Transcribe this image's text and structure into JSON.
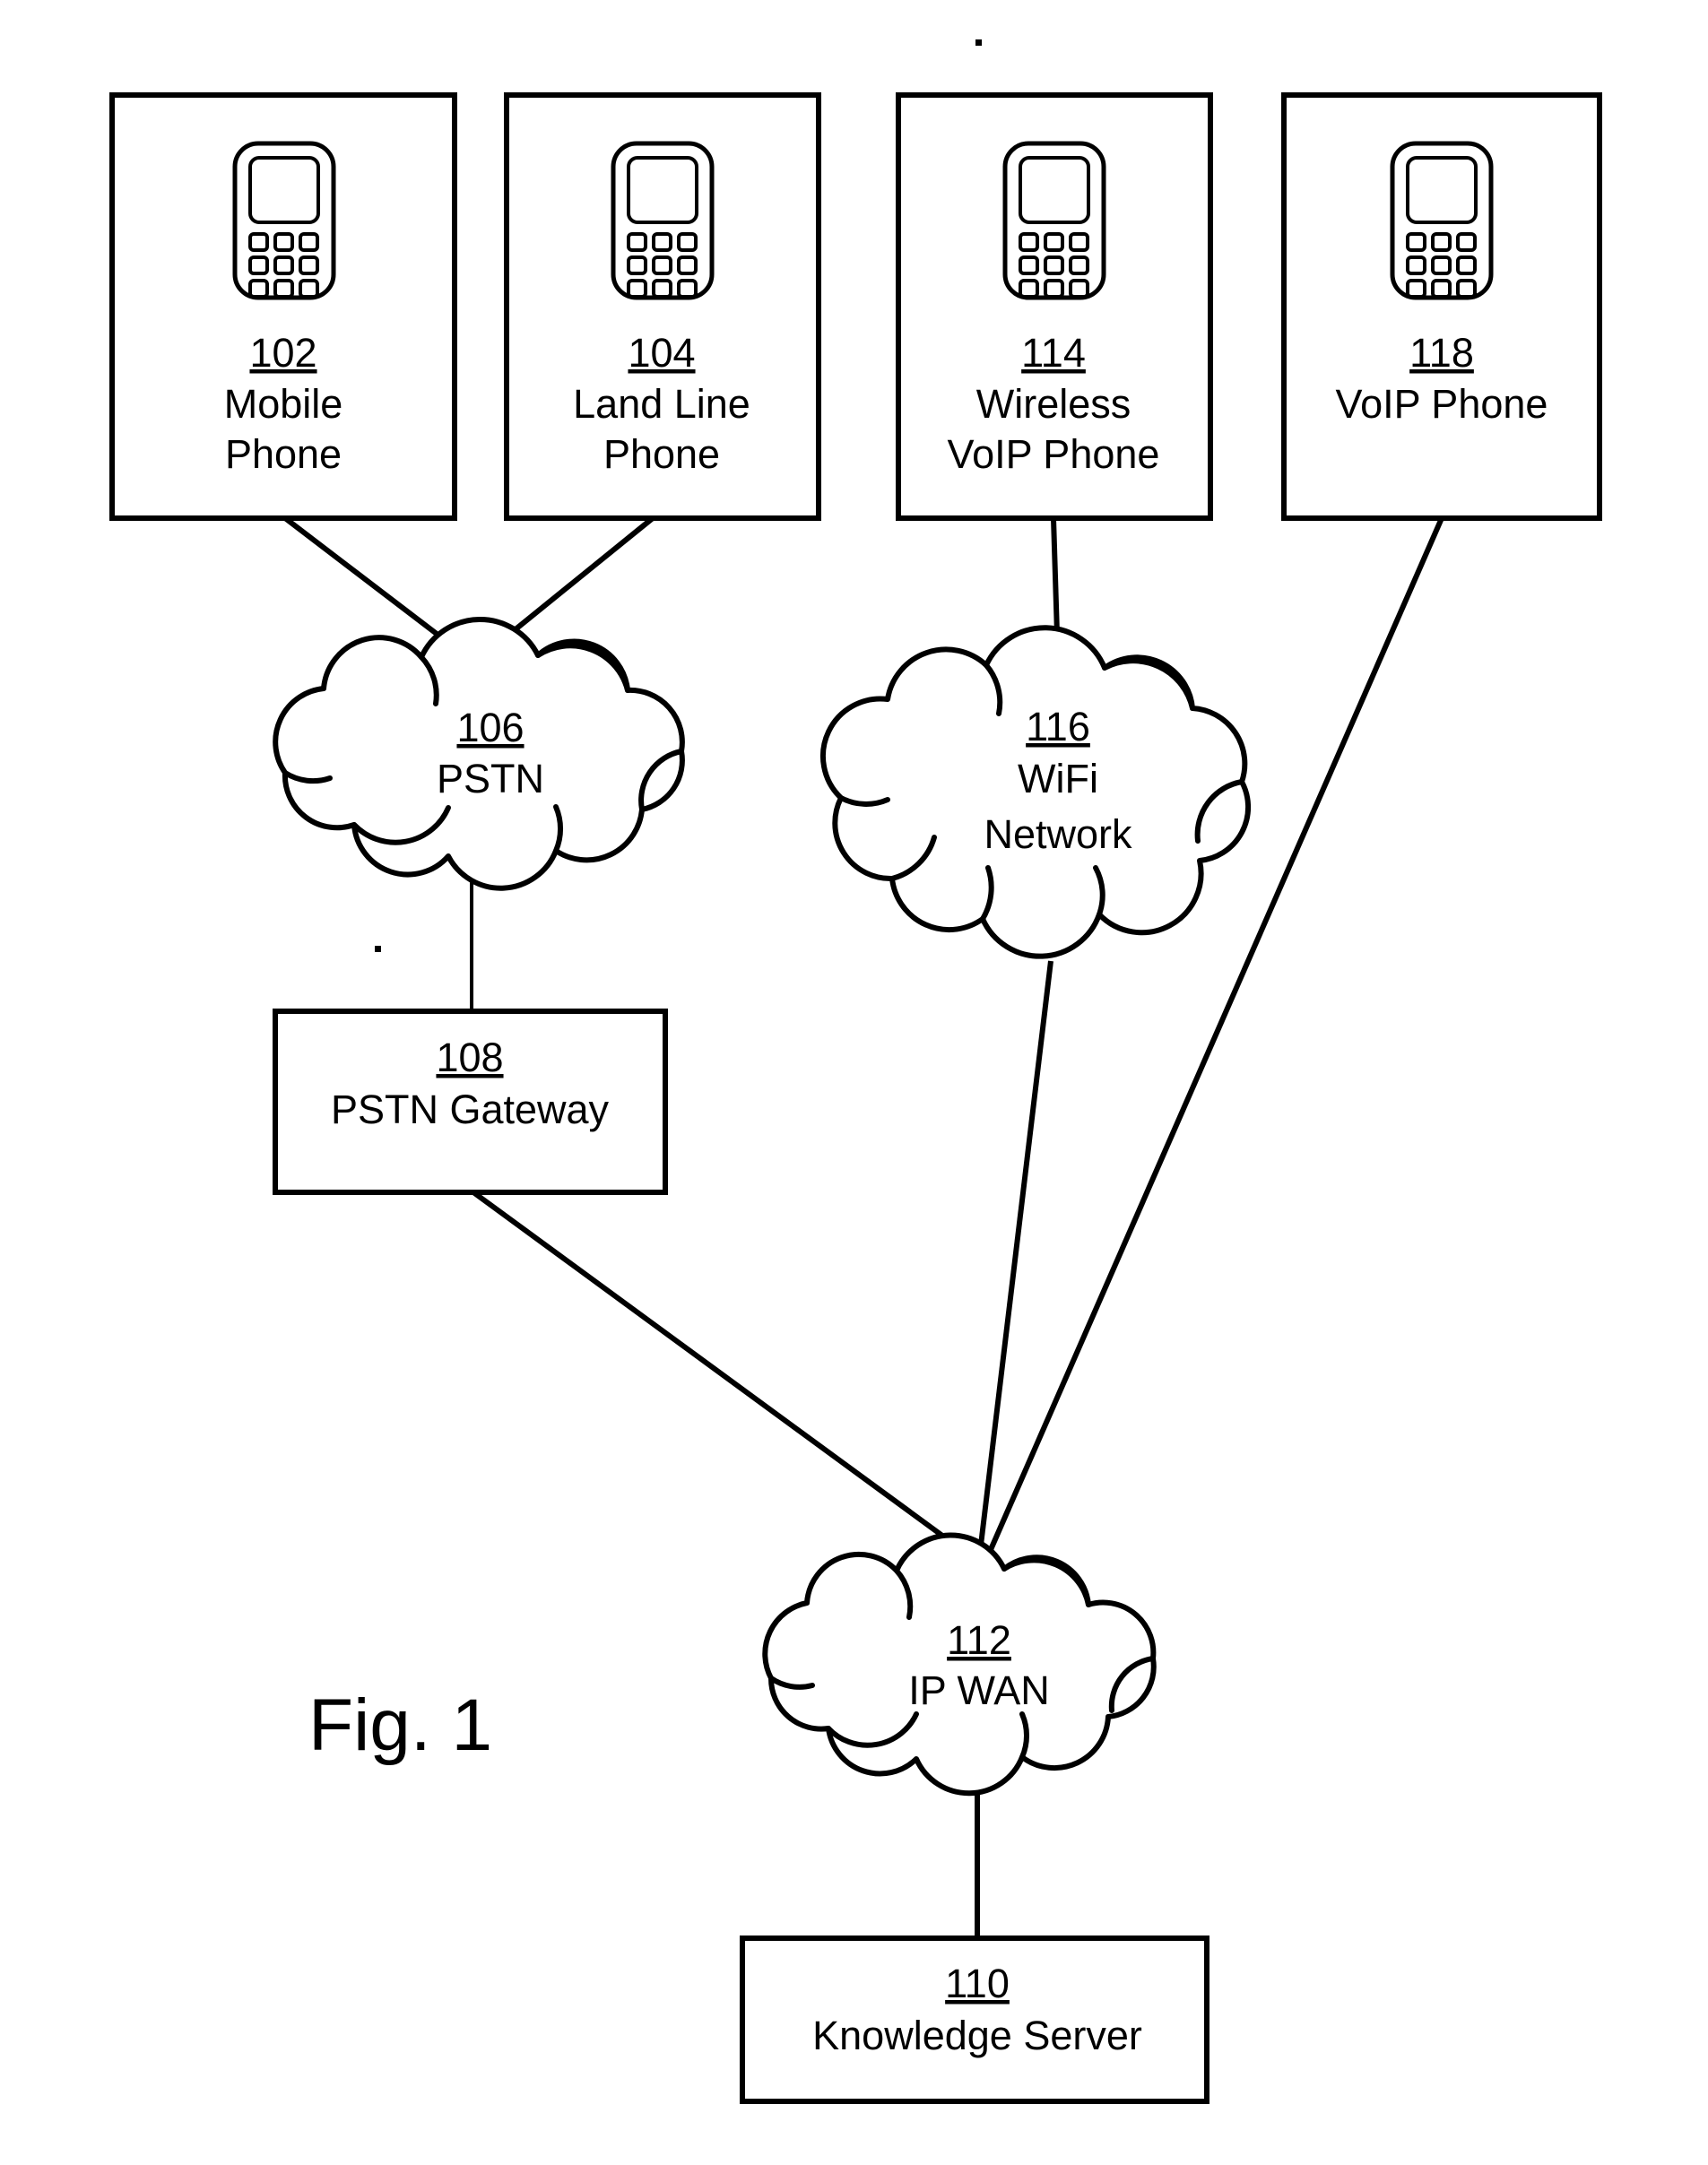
{
  "figure": {
    "caption": "Fig. 1"
  },
  "nodes": [
    {
      "id": "mobile-phone",
      "ref": "102",
      "label_lines": [
        "Mobile",
        "Phone"
      ],
      "shape": "box",
      "icon": "mobile-phone-icon"
    },
    {
      "id": "land-line-phone",
      "ref": "104",
      "label_lines": [
        "Land Line",
        "Phone"
      ],
      "shape": "box",
      "icon": "mobile-phone-icon"
    },
    {
      "id": "wireless-voip-phone",
      "ref": "114",
      "label_lines": [
        "Wireless",
        "VoIP Phone"
      ],
      "shape": "box",
      "icon": "mobile-phone-icon"
    },
    {
      "id": "voip-phone",
      "ref": "118",
      "label_lines": [
        "VoIP Phone"
      ],
      "shape": "box",
      "icon": "mobile-phone-icon"
    },
    {
      "id": "pstn",
      "ref": "106",
      "label_lines": [
        "PSTN"
      ],
      "shape": "cloud"
    },
    {
      "id": "wifi-network",
      "ref": "116",
      "label_lines": [
        "WiFi",
        "Network"
      ],
      "shape": "cloud"
    },
    {
      "id": "pstn-gateway",
      "ref": "108",
      "label_lines": [
        "PSTN Gateway"
      ],
      "shape": "box"
    },
    {
      "id": "ip-wan",
      "ref": "112",
      "label_lines": [
        "IP WAN"
      ],
      "shape": "cloud"
    },
    {
      "id": "knowledge-server",
      "ref": "110",
      "label_lines": [
        "Knowledge Server"
      ],
      "shape": "box"
    }
  ],
  "connections": [
    {
      "from": "mobile-phone",
      "to": "pstn"
    },
    {
      "from": "land-line-phone",
      "to": "pstn"
    },
    {
      "from": "wireless-voip-phone",
      "to": "wifi-network"
    },
    {
      "from": "pstn",
      "to": "pstn-gateway"
    },
    {
      "from": "wifi-network",
      "to": "ip-wan"
    },
    {
      "from": "voip-phone",
      "to": "ip-wan"
    },
    {
      "from": "pstn-gateway",
      "to": "ip-wan"
    },
    {
      "from": "ip-wan",
      "to": "knowledge-server"
    }
  ],
  "colors": {
    "stroke": "#000000",
    "background": "#ffffff"
  }
}
